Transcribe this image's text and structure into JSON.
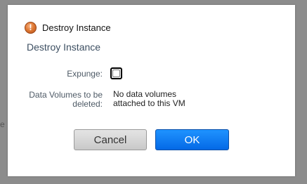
{
  "background": {
    "fragment": "e"
  },
  "dialog": {
    "title": "Destroy Instance",
    "title_icon": "alert-icon",
    "heading": "Destroy Instance",
    "expunge": {
      "label": "Expunge:",
      "checked": false
    },
    "data_volumes": {
      "label": "Data Volumes to be deleted:",
      "value": "No data volumes attached to this VM"
    },
    "buttons": {
      "cancel": "Cancel",
      "ok": "OK"
    }
  },
  "colors": {
    "ok_button": "#0a7cf5",
    "cancel_button": "#d6d6d6",
    "alert_icon": "#e07a35",
    "overlay": "#8c8c8c"
  }
}
